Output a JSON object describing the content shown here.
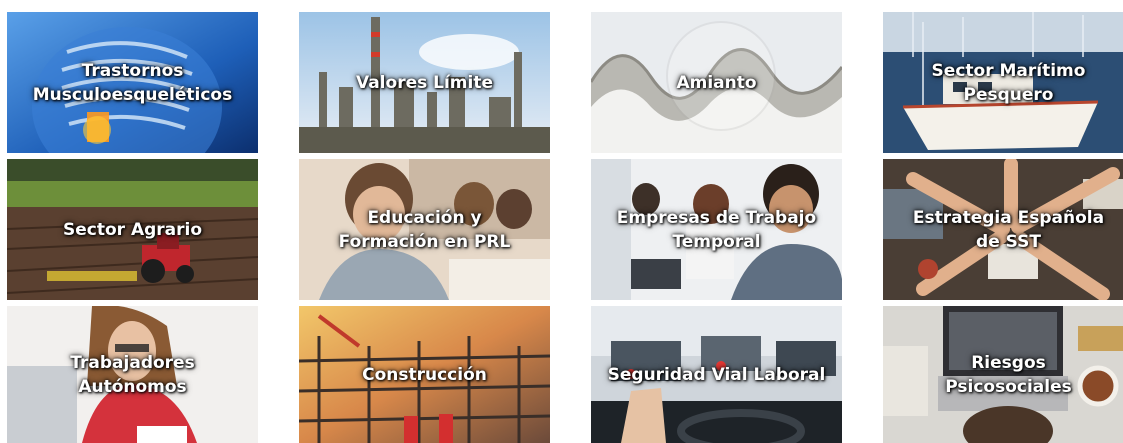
{
  "tiles": [
    {
      "label": "Trastornos\nMusculoesqueléticos",
      "icon": "spine-xray-image"
    },
    {
      "label": "Valores Límite",
      "icon": "refinery-image"
    },
    {
      "label": "Amianto",
      "icon": "asbestos-roof-image"
    },
    {
      "label": "Sector Marítimo\nPesquero",
      "icon": "fishing-boat-image"
    },
    {
      "label": "Sector Agrario",
      "icon": "tractor-field-image"
    },
    {
      "label": "Educación y\nFormación en PRL",
      "icon": "students-classroom-image"
    },
    {
      "label": "Empresas de Trabajo\nTemporal",
      "icon": "call-center-image"
    },
    {
      "label": "Estrategia Española\nde SST",
      "icon": "team-hands-image"
    },
    {
      "label": "Trabajadores\nAutónomos",
      "icon": "freelancer-laptop-image"
    },
    {
      "label": "Construcción",
      "icon": "construction-site-image"
    },
    {
      "label": "Seguridad Vial Laboral",
      "icon": "traffic-driver-image"
    },
    {
      "label": "Riesgos\nPsicosociales",
      "icon": "stressed-worker-image"
    }
  ]
}
